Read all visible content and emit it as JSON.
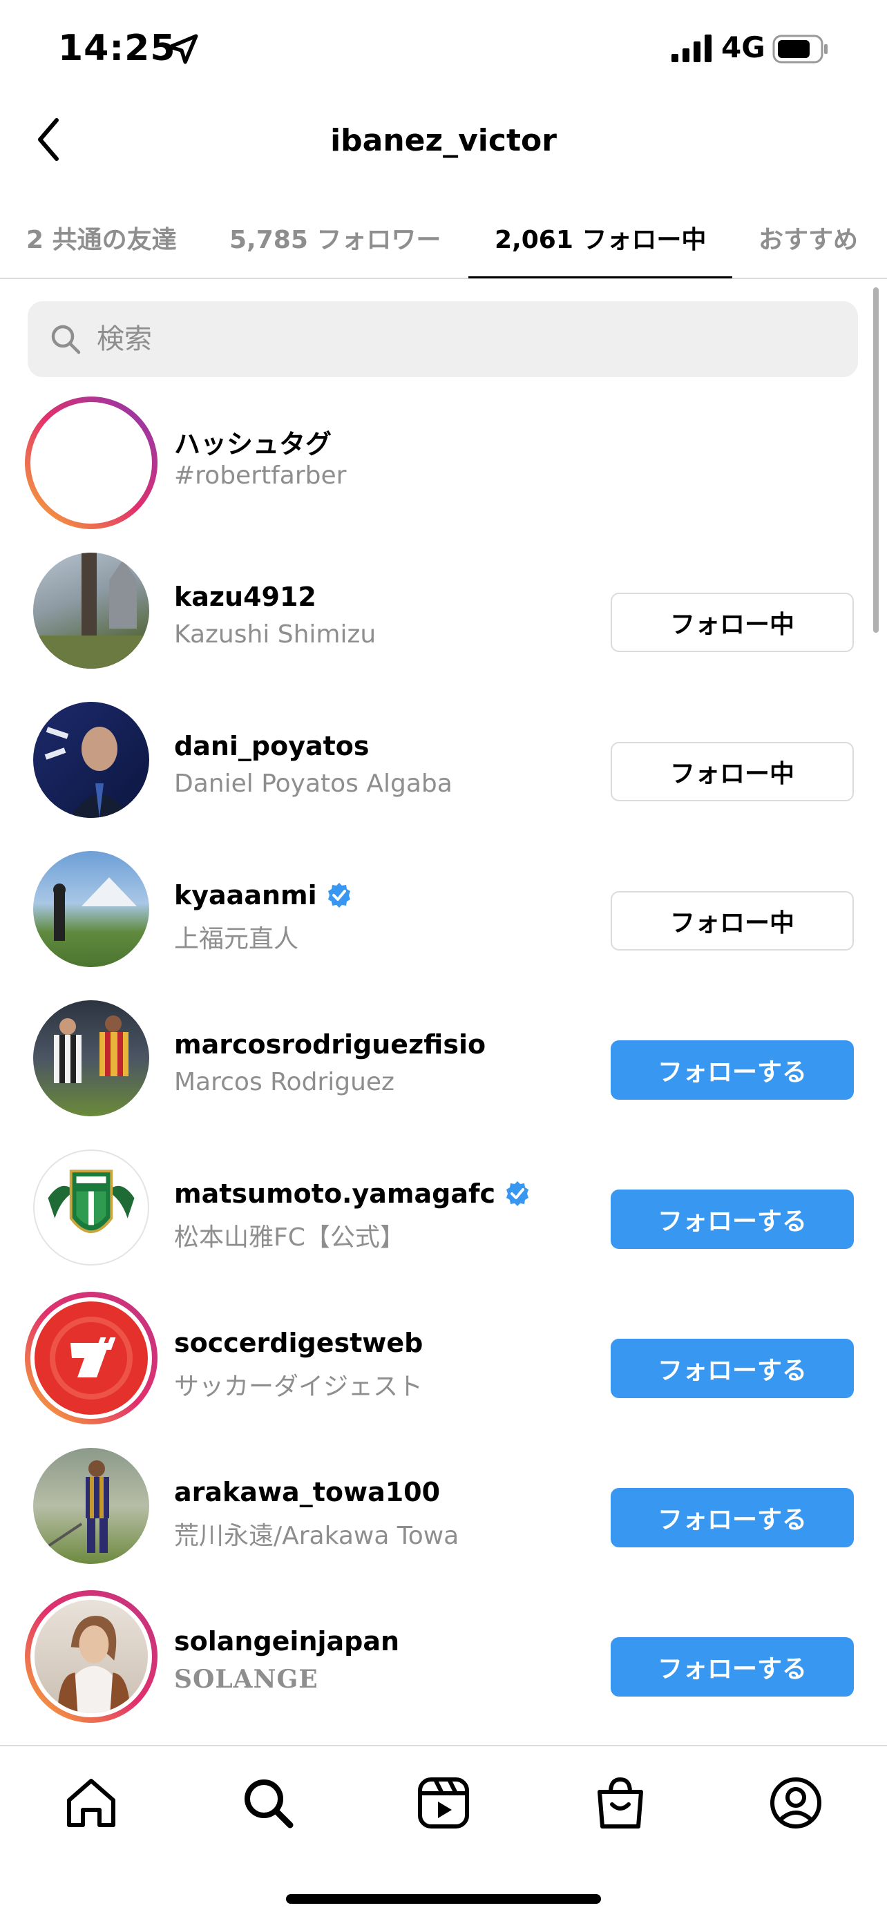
{
  "status": {
    "time": "14:25",
    "network": "4G"
  },
  "header": {
    "title": "ibanez_victor"
  },
  "tabs": [
    {
      "label": "2 共通の友達",
      "active": false
    },
    {
      "label": "5,785 フォロワー",
      "active": false
    },
    {
      "label": "2,061 フォロー中",
      "active": true
    },
    {
      "label": "おすすめ",
      "active": false
    }
  ],
  "search": {
    "placeholder": "検索"
  },
  "accounts": [
    {
      "username": "ハッシュタグ",
      "name": "#robertfarber",
      "verified": false,
      "button": ""
    },
    {
      "username": "kazu4912",
      "name": "Kazushi Shimizu",
      "verified": false,
      "button": "フォロー中"
    },
    {
      "username": "dani_poyatos",
      "name": "Daniel Poyatos Algaba",
      "verified": false,
      "button": "フォロー中"
    },
    {
      "username": "kyaaanmi",
      "name": "上福元直人",
      "verified": true,
      "button": "フォロー中"
    },
    {
      "username": "marcosrodriguezfisio",
      "name": "Marcos Rodriguez",
      "verified": false,
      "button": "フォローする"
    },
    {
      "username": "matsumoto.yamagafc",
      "name": "松本山雅FC【公式】",
      "verified": true,
      "button": "フォローする"
    },
    {
      "username": "soccerdigestweb",
      "name": "サッカーダイジェスト",
      "verified": false,
      "button": "フォローする"
    },
    {
      "username": "arakawa_towa100",
      "name": "荒川永遠/Arakawa Towa",
      "verified": false,
      "button": "フォローする"
    },
    {
      "username": "solangeinjapan",
      "name": "SOLANGE",
      "verified": false,
      "button": "フォローする"
    }
  ],
  "colors": {
    "follow_blue": "#3897f0",
    "secondary_text": "#8e8e8e",
    "verified_blue": "#3897f0"
  },
  "icons": {
    "nav": [
      "home-icon",
      "search-icon",
      "reels-icon",
      "shop-icon",
      "profile-icon"
    ]
  }
}
